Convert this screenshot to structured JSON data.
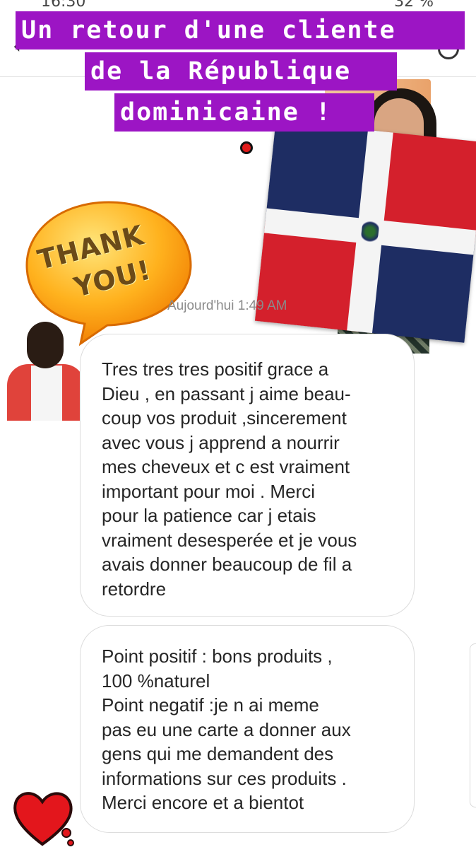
{
  "status_bar": {
    "time": "16:30",
    "battery": "32 %"
  },
  "banner": {
    "lines": [
      "Un retour d'une cliente",
      "de la République",
      "dominicaine !"
    ],
    "background_color": "#9c15c4"
  },
  "sticker": {
    "thank_line1": "THANK",
    "thank_line2": "YOU!"
  },
  "conversation": {
    "timestamp": "Aujourd'hui 1:49 AM",
    "messages": [
      "Tres tres tres positif grace a\nDieu , en passant j aime beau-\ncoup vos produit ,sincerement\navec vous j apprend a nourrir\nmes cheveux et c est vraiment\nimportant pour moi . Merci\npour la patience car j etais\nvraiment desesperée et je vous\navais donner beaucoup de fil a\nretordre",
      "Point positif : bons produits ,\n100 %naturel\nPoint negatif :je n ai meme\npas eu une carte a donner aux\ngens qui me demandent des\ninformations sur ces produits .\nMerci encore et a bientot"
    ]
  },
  "icons": {
    "back": "back-arrow-icon",
    "info": "info-icon",
    "heart": "heart-icon"
  },
  "colors": {
    "flag_blue": "#1e2d63",
    "flag_red": "#d4202c",
    "bubble_border": "#dcdcdc"
  }
}
